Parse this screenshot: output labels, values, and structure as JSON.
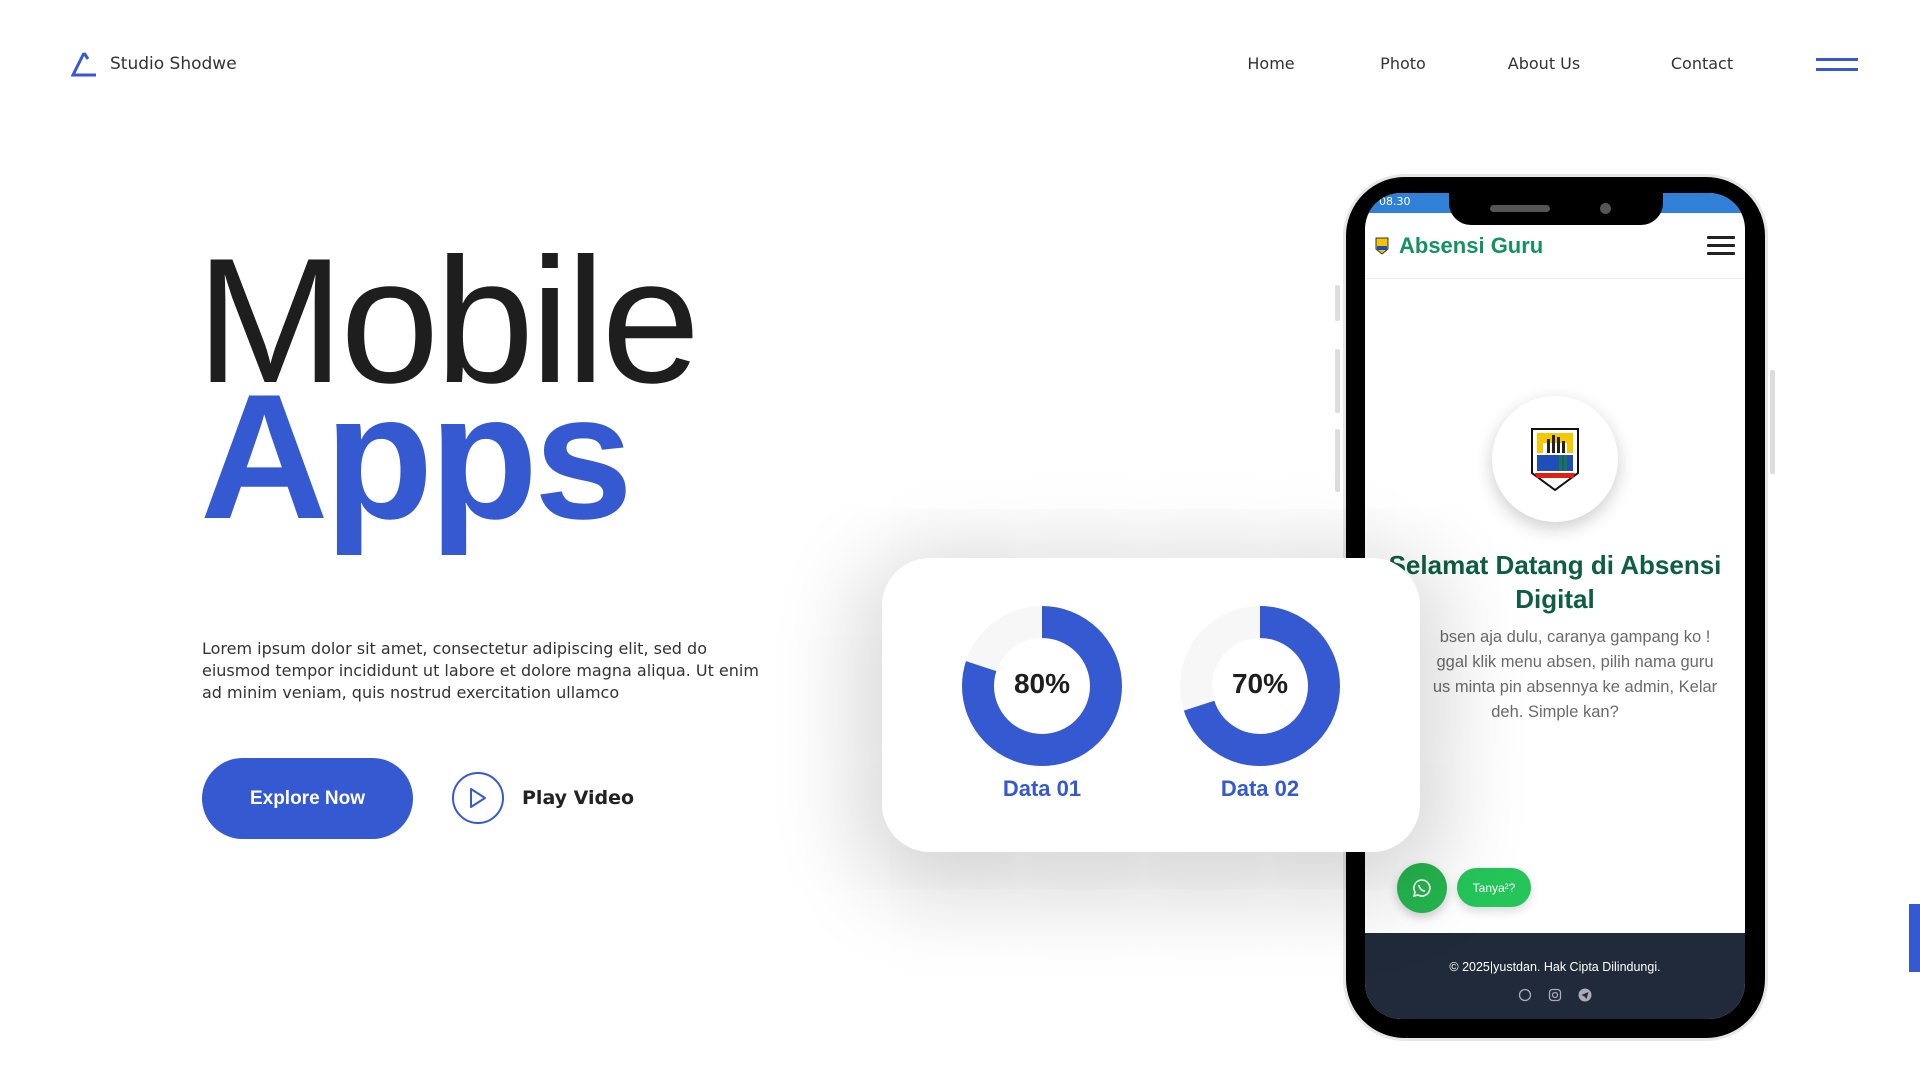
{
  "brand": {
    "name": "Studio Shodwe"
  },
  "nav": {
    "items": [
      "Home",
      "Photo",
      "About Us",
      "Contact"
    ],
    "menu_icon": "hamburger-icon"
  },
  "hero": {
    "title_line1": "Mobile",
    "title_line2": "Apps",
    "description": "Lorem ipsum dolor sit amet, consectetur adipiscing elit, sed do eiusmod tempor incididunt ut labore et dolore magna aliqua. Ut enim ad minim veniam, quis nostrud exercitation ullamco",
    "explore_label": "Explore Now",
    "play_label": "Play Video"
  },
  "stats_card": {
    "items": [
      {
        "label": "Data 01",
        "value": 80,
        "text": "80%"
      },
      {
        "label": "Data 02",
        "value": 70,
        "text": "70%"
      }
    ],
    "fill_color": "#3559d0",
    "track_color": "#f7f7f7"
  },
  "phone": {
    "status_time": "08.30",
    "app_title": "Absensi Guru",
    "welcome_title": "Selamat Datang di Absensi Digital",
    "welcome_lines": [
      "bsen aja dulu, caranya gampang ko !",
      "ggal klik menu absen, pilih nama guru",
      "us minta pin absennya ke admin, Kelar",
      "deh. Simple kan?"
    ],
    "ask_label": "Tanya²?",
    "footer": "© 2025|yustdan. Hak Cipta Dilindungi.",
    "footer_icons": [
      "whatsapp-icon",
      "instagram-icon",
      "telegram-icon"
    ]
  },
  "colors": {
    "accent": "#3559d0",
    "app_green": "#129163",
    "footer_bg": "#202a3a"
  }
}
